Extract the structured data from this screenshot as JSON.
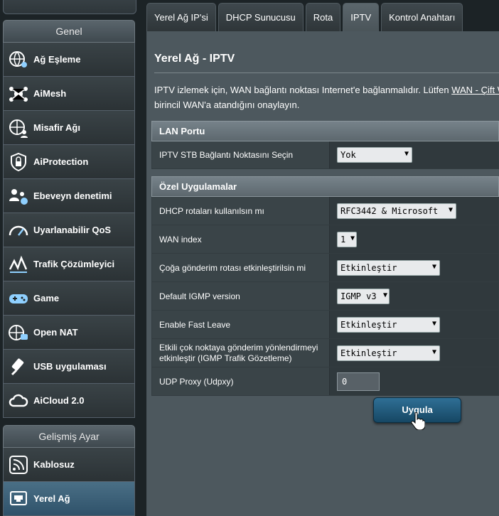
{
  "sidebar": {
    "group1_title": "Genel",
    "group1_items": [
      {
        "label": "Ağ Eşleme",
        "icon": "network-map-icon"
      },
      {
        "label": "AiMesh",
        "icon": "aimesh-icon"
      },
      {
        "label": "Misafir Ağı",
        "icon": "guest-network-icon"
      },
      {
        "label": "AiProtection",
        "icon": "shield-lock-icon"
      },
      {
        "label": "Ebeveyn denetimi",
        "icon": "parental-control-icon"
      },
      {
        "label": "Uyarlanabilir QoS",
        "icon": "speedometer-icon"
      },
      {
        "label": "Trafik Çözümleyici",
        "icon": "traffic-analyzer-icon"
      },
      {
        "label": "Game",
        "icon": "gamepad-icon"
      },
      {
        "label": "Open NAT",
        "icon": "open-nat-icon"
      },
      {
        "label": "USB uygulaması",
        "icon": "usb-icon"
      },
      {
        "label": "AiCloud 2.0",
        "icon": "cloud-icon"
      }
    ],
    "group2_title": "Gelişmiş Ayar",
    "group2_items": [
      {
        "label": "Kablosuz",
        "icon": "wireless-icon"
      },
      {
        "label": "Yerel Ağ",
        "icon": "lan-icon"
      }
    ]
  },
  "tabs": [
    "Yerel Ağ IP'si",
    "DHCP Sunucusu",
    "Rota",
    "IPTV",
    "Kontrol Anahtarı"
  ],
  "active_tab": "IPTV",
  "main": {
    "title": "Yerel Ağ - IPTV",
    "desc_line1": "IPTV izlemek için, WAN bağlantı noktası Internet'e bağlanmalıdır. Lütfen ",
    "desc_link": "WAN - Çift W",
    "desc_line2": "birincil WAN'a atandığını onaylayın.",
    "lan_section": {
      "header": "LAN Portu",
      "rows": [
        {
          "label": "IPTV STB Bağlantı Noktasını Seçin",
          "value": "Yok"
        }
      ]
    },
    "special_section": {
      "header": "Özel Uygulamalar",
      "rows": [
        {
          "label": "DHCP rotaları kullanılsın mı",
          "value": "RFC3442 & Microsoft"
        },
        {
          "label": "WAN index",
          "value": "1"
        },
        {
          "label": "Çoğa gönderim rotası etkinleştirilsin mi",
          "value": "Etkinleştir"
        },
        {
          "label": "Default IGMP version",
          "value": "IGMP v3"
        },
        {
          "label": "Enable Fast Leave",
          "value": "Etkinleştir"
        },
        {
          "label": "Etkili çok noktaya gönderim yönlendirmeyi etkinleştir (IGMP Trafik Gözetleme)",
          "value": "Etkinleştir"
        },
        {
          "label": "UDP Proxy (Udpxy)",
          "value": "0"
        }
      ]
    },
    "apply_label": "Uygula"
  },
  "colors": {
    "background": "#1c2326",
    "panel": "#4d585e",
    "accent": "#1d5a80"
  }
}
